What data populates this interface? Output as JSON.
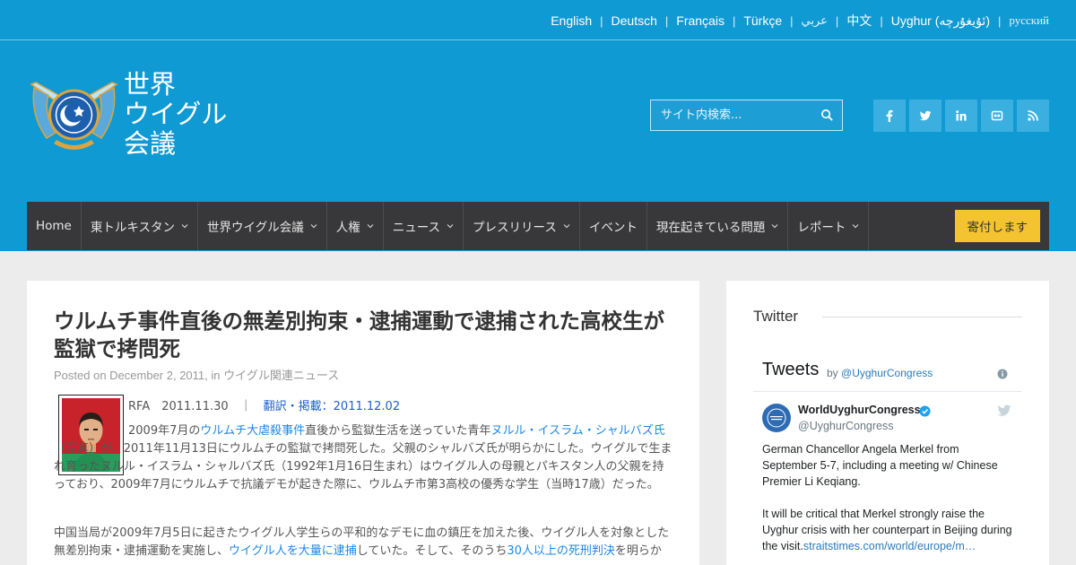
{
  "languages": [
    {
      "label": "English"
    },
    {
      "label": "Deutsch"
    },
    {
      "label": "Français"
    },
    {
      "label": "Türkçe"
    },
    {
      "label": "عربي"
    },
    {
      "label": "中文"
    },
    {
      "label": "Uyghur (ئۇيغۇرچە)"
    },
    {
      "label": "русский"
    }
  ],
  "logo": {
    "line1": "世界",
    "line2": "ウイグル",
    "line3": "会議"
  },
  "search": {
    "placeholder": "サイト内検索..."
  },
  "social_icons": [
    "facebook-icon",
    "twitter-icon",
    "linkedin-icon",
    "flickr-icon",
    "rss-icon"
  ],
  "nav": {
    "items": [
      {
        "label": "Home",
        "has_dropdown": false
      },
      {
        "label": "東トルキスタン",
        "has_dropdown": true
      },
      {
        "label": "世界ウイグル会議",
        "has_dropdown": true
      },
      {
        "label": "人権",
        "has_dropdown": true
      },
      {
        "label": "ニュース",
        "has_dropdown": true
      },
      {
        "label": "プレスリリース",
        "has_dropdown": true
      },
      {
        "label": "イベント",
        "has_dropdown": false
      },
      {
        "label": "現在起きている問題",
        "has_dropdown": true
      },
      {
        "label": "レポート",
        "has_dropdown": true
      }
    ],
    "donate_label": "寄付します"
  },
  "article": {
    "title": "ウルムチ事件直後の無差別拘束・逮捕運動で逮捕された高校生が監獄で拷問死",
    "meta_prefix": "Posted on December 2, 2011, in ",
    "meta_category": "ウイグル関連ニュース",
    "byline_source": "RFA　2011.11.30　｜　",
    "byline_translation": "翻訳・掲載：2011.12.02",
    "p1_a": "2009年7月の",
    "p1_link1": "ウルムチ大虐殺事件",
    "p1_b": "直後から監獄生活を送っていた青年",
    "p1_link2": "ヌルル・イスラム・シャルバズ氏",
    "p1_c": "（写真）が、2011年11月13日にウルムチの監獄で拷問死した。父親のシャルバズ氏が明らかにした。ウイグルで生まれ育ったヌルル・イスラム・シャルバズ氏（1992年1月16日生まれ）はウイグル人の母親とパキスタン人の父親を持っており、2009年7月にウルムチで抗議デモが起きた際に、ウルムチ市第3高校の優秀な学生（当時17歳）だった。",
    "p2_a": "中国当局が2009年7月5日に起きたウイグル人学生らの平和的なデモに血の鎮圧を加えた後、ウイグル人を対象とした無差別拘束・逮捕運動を実施し、",
    "p2_link1": "ウイグル人を大量に逮捕",
    "p2_b": "していた。そして、そのうち",
    "p2_link2": "30人以上の死刑判決",
    "p2_c": "を明らか"
  },
  "sidebar": {
    "widget_title": "Twitter",
    "timeline_title": "Tweets",
    "by_prefix": "by ",
    "by_handle": "@UyghurCongress",
    "tweet": {
      "name": "WorldUyghurCongress",
      "handle": "@UyghurCongress",
      "text1": "German Chancellor Angela Merkel from September 5-7, including a meeting w/ Chinese Premier Li Keqiang.",
      "text2": "It will be critical that Merkel strongly raise the Uyghur crisis with her counterpart in Beijing during the visit.",
      "link": "straitstimes.com/world/europe/m…"
    }
  },
  "colors": {
    "header_blue": "#0f9ad3",
    "nav_dark": "#38383a",
    "donate_yellow": "#f4c430",
    "link_blue": "#1e88e5"
  }
}
